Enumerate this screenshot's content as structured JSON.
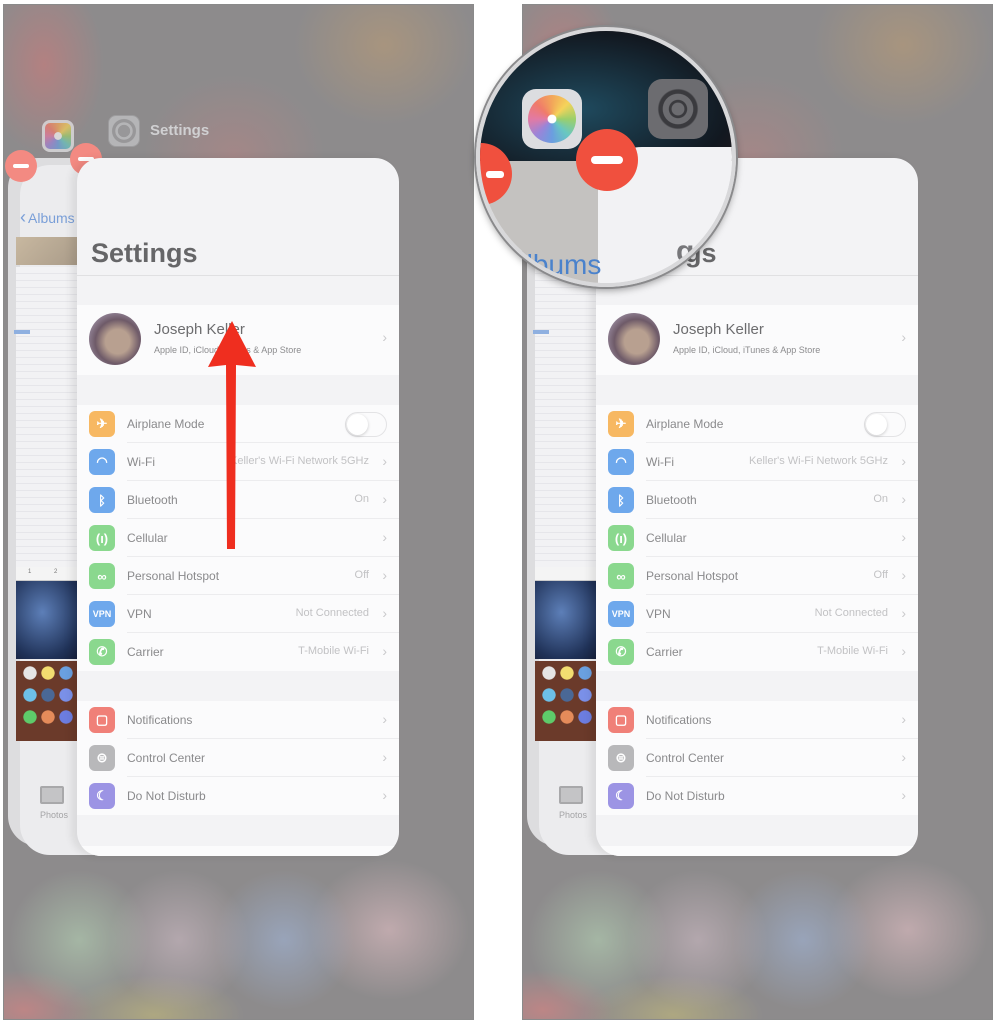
{
  "panels": [
    {
      "id": "left",
      "switcher": {
        "app_label": "Settings",
        "background_app": {
          "back_label": "Albums",
          "tab_label": "Photos",
          "ruler_ticks": [
            "1",
            "2"
          ]
        }
      },
      "annotation": {
        "type": "swipe-up-arrow",
        "color": "#ef2e1f"
      }
    },
    {
      "id": "right",
      "magnifier": {
        "albums_text": "Albums",
        "settings_text": "gs"
      },
      "background_app": {
        "tab_label": "Photos"
      }
    }
  ],
  "settings": {
    "title": "Settings",
    "profile": {
      "name": "Joseph Keller",
      "subtitle": "Apple ID, iCloud, iTunes & App Store"
    },
    "groups": [
      {
        "rows": [
          {
            "label": "Airplane Mode",
            "icon": "airplane-icon",
            "glyph": "✈",
            "color": "#f7b862",
            "type": "toggle",
            "on": false
          },
          {
            "label": "Wi-Fi",
            "icon": "wifi-icon",
            "glyph": "◠",
            "color": "#6ea8ec",
            "value": "Keller's Wi-Fi Network 5GHz"
          },
          {
            "label": "Bluetooth",
            "icon": "bluetooth-icon",
            "glyph": "ᛒ",
            "color": "#6ea8ec",
            "value": "On"
          },
          {
            "label": "Cellular",
            "icon": "cellular-icon",
            "glyph": "(ı)",
            "color": "#8ad88e",
            "value": ""
          },
          {
            "label": "Personal Hotspot",
            "icon": "hotspot-icon",
            "glyph": "∞",
            "color": "#8ad88e",
            "value": "Off"
          },
          {
            "label": "VPN",
            "icon": "vpn-icon",
            "glyph": "VPN",
            "color": "#6ea8ec",
            "value": "Not Connected"
          },
          {
            "label": "Carrier",
            "icon": "phone-icon",
            "glyph": "✆",
            "color": "#8ad88e",
            "value": "T-Mobile Wi-Fi"
          }
        ]
      },
      {
        "rows": [
          {
            "label": "Notifications",
            "icon": "notifications-icon",
            "glyph": "▢",
            "color": "#f08078",
            "value": ""
          },
          {
            "label": "Control Center",
            "icon": "control-center-icon",
            "glyph": "⊜",
            "color": "#b8b8ba",
            "value": ""
          },
          {
            "label": "Do Not Disturb",
            "icon": "moon-icon",
            "glyph": "☾",
            "color": "#9c94e4",
            "value": ""
          }
        ]
      }
    ]
  }
}
